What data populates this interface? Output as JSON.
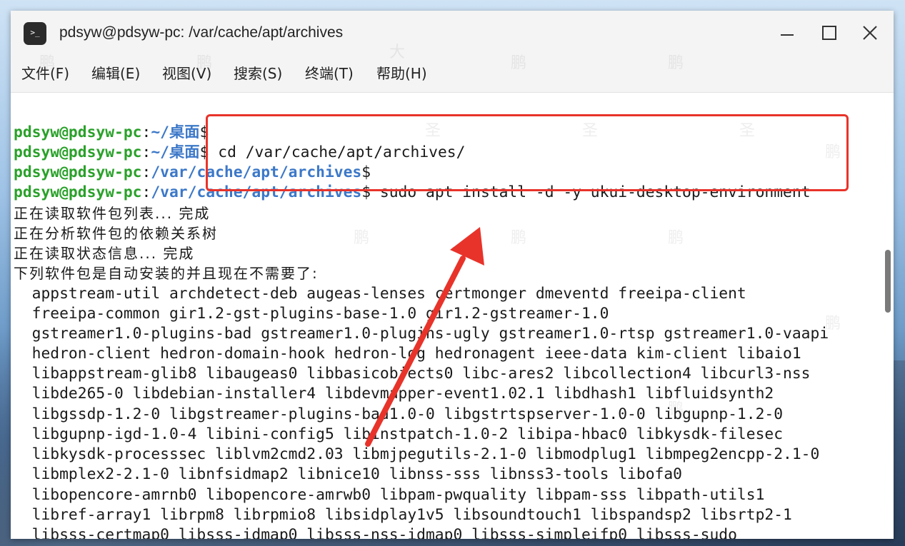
{
  "window": {
    "title": "pdsyw@pdsyw-pc: /var/cache/apt/archives",
    "icon_glyph": ">_"
  },
  "menu": [
    {
      "label": "文件(F)"
    },
    {
      "label": "编辑(E)"
    },
    {
      "label": "视图(V)"
    },
    {
      "label": "搜索(S)"
    },
    {
      "label": "终端(T)"
    },
    {
      "label": "帮助(H)"
    }
  ],
  "prompts": [
    {
      "user": "pdsyw@pdsyw-pc",
      "path": "~/桌面",
      "command": ""
    },
    {
      "user": "pdsyw@pdsyw-pc",
      "path": "~/桌面",
      "command": " cd /var/cache/apt/archives/"
    },
    {
      "user": "pdsyw@pdsyw-pc",
      "path": "/var/cache/apt/archives",
      "command": ""
    },
    {
      "user": "pdsyw@pdsyw-pc",
      "path": "/var/cache/apt/archives",
      "command": " sudo apt install -d -y ukui-desktop-environment"
    }
  ],
  "output_cn": [
    "正在读取软件包列表... 完成",
    "正在分析软件包的依赖关系树",
    "正在读取状态信息... 完成",
    "下列软件包是自动安装的并且现在不需要了:"
  ],
  "output_packages": [
    "  appstream-util archdetect-deb augeas-lenses certmonger dmeventd freeipa-client",
    "  freeipa-common gir1.2-gst-plugins-base-1.0 gir1.2-gstreamer-1.0",
    "  gstreamer1.0-plugins-bad gstreamer1.0-plugins-ugly gstreamer1.0-rtsp gstreamer1.0-vaapi",
    "  hedron-client hedron-domain-hook hedron-log hedronagent ieee-data kim-client libaio1",
    "  libappstream-glib8 libaugeas0 libbasicobjects0 libc-ares2 libcollection4 libcurl3-nss",
    "  libde265-0 libdebian-installer4 libdevmapper-event1.02.1 libdhash1 libfluidsynth2",
    "  libgssdp-1.2-0 libgstreamer-plugins-bad1.0-0 libgstrtspserver-1.0-0 libgupnp-1.2-0",
    "  libgupnp-igd-1.0-4 libini-config5 libinstpatch-1.0-2 libipa-hbac0 libkysdk-filesec",
    "  libkysdk-processsec liblvm2cmd2.03 libmjpegutils-2.1-0 libmodplug1 libmpeg2encpp-2.1-0",
    "  libmplex2-2.1-0 libnfsidmap2 libnice10 libnss-sss libnss3-tools libofa0",
    "  libopencore-amrnb0 libopencore-amrwb0 libpam-pwquality libpam-sss libpath-utils1",
    "  libref-array1 librpm8 librpmio8 libsidplay1v5 libsoundtouch1 libspandsp2 libsrtp2-1",
    "  libsss-certmap0 libsss-idmap0 libsss-nss-idmap0 libsss-simpleifp0 libsss-sudo"
  ],
  "watermark": {
    "text_a": "鹏",
    "text_b": "大",
    "text_c": "圣"
  },
  "colors": {
    "prompt_user": "#2aa12a",
    "prompt_path": "#3c78c8",
    "annotation": "#e8332a"
  }
}
